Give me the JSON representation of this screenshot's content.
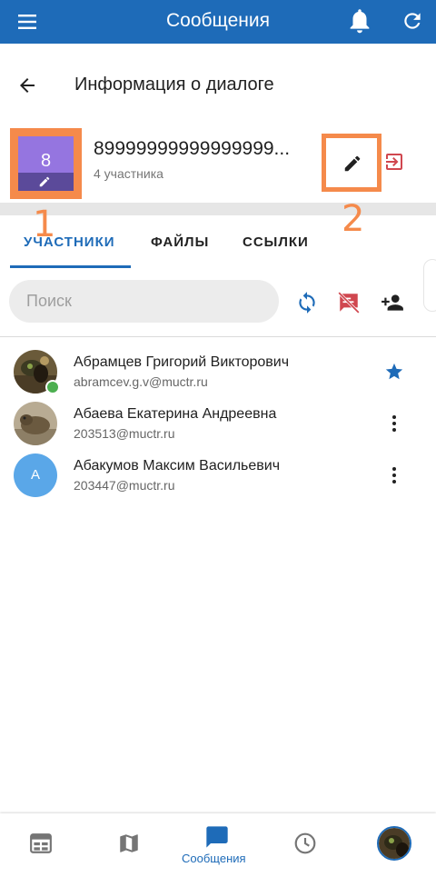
{
  "appbar": {
    "title": "Сообщения",
    "bg_color": "#1e6bb8",
    "icons": [
      "menu-icon",
      "bell-icon",
      "refresh-icon"
    ]
  },
  "header": {
    "title": "Информация о диалоге"
  },
  "dialog": {
    "avatar_text": "8",
    "name": "89999999999999999...",
    "participants": "4 участника"
  },
  "annotations": {
    "mark1": "1",
    "mark2": "2",
    "color": "#f58a4b"
  },
  "tabs": [
    {
      "label": "УЧАСТНИКИ",
      "active": true
    },
    {
      "label": "ФАЙЛЫ",
      "active": false
    },
    {
      "label": "ССЫЛКИ",
      "active": false
    }
  ],
  "search": {
    "placeholder": "Поиск"
  },
  "members": [
    {
      "name": "Абрамцев Григорий Викторович",
      "email": "abramcev.g.v@muctr.ru",
      "online": true,
      "action": "star-icon"
    },
    {
      "name": "Абаева Екатерина Андреевна",
      "email": "203513@muctr.ru",
      "online": false,
      "action": "more-vert-icon"
    },
    {
      "name": "Абакумов Максим Васильевич",
      "email": "203447@muctr.ru",
      "online": false,
      "avatar_letter": "A",
      "action": "more-vert-icon"
    }
  ],
  "bottom_nav": {
    "active_label": "Сообщения",
    "items": [
      "calendar-icon",
      "map-icon",
      "chat-icon",
      "clock-icon",
      "profile-avatar"
    ]
  }
}
